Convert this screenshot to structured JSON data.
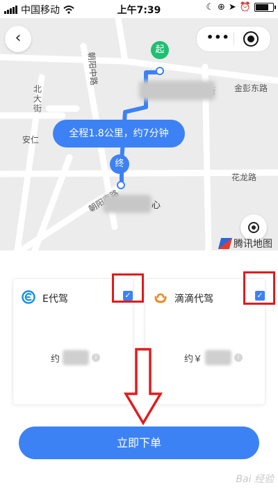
{
  "status_bar": {
    "carrier": "中国移动",
    "time": "上午7:39"
  },
  "map": {
    "labels": {
      "chaoyang_middle": "朝阳中路",
      "jinpeng_east": "金彭东路",
      "beidajie": "北\n大\n街",
      "anren": "安仁",
      "hualong": "花龙路",
      "chaoyang_south": "朝阳南路",
      "street_fragment": "街"
    },
    "route_summary": "全程1.8公里，约7分钟",
    "start_label": "起",
    "end_label": "终",
    "poi_suffix": "心",
    "provider": "腾讯地图"
  },
  "options": [
    {
      "name": "E代驾",
      "price_prefix": "约",
      "checked": true,
      "brand_color": "#1a8fe3"
    },
    {
      "name": "滴滴代驾",
      "price_prefix": "约￥",
      "checked": true,
      "brand_color": "#f08a24"
    }
  ],
  "order_button": "立即下单",
  "watermark": "Bai 经验",
  "colors": {
    "accent": "#3d82f5",
    "start_pin": "#1fbf72",
    "annotation": "#e11b1b"
  }
}
